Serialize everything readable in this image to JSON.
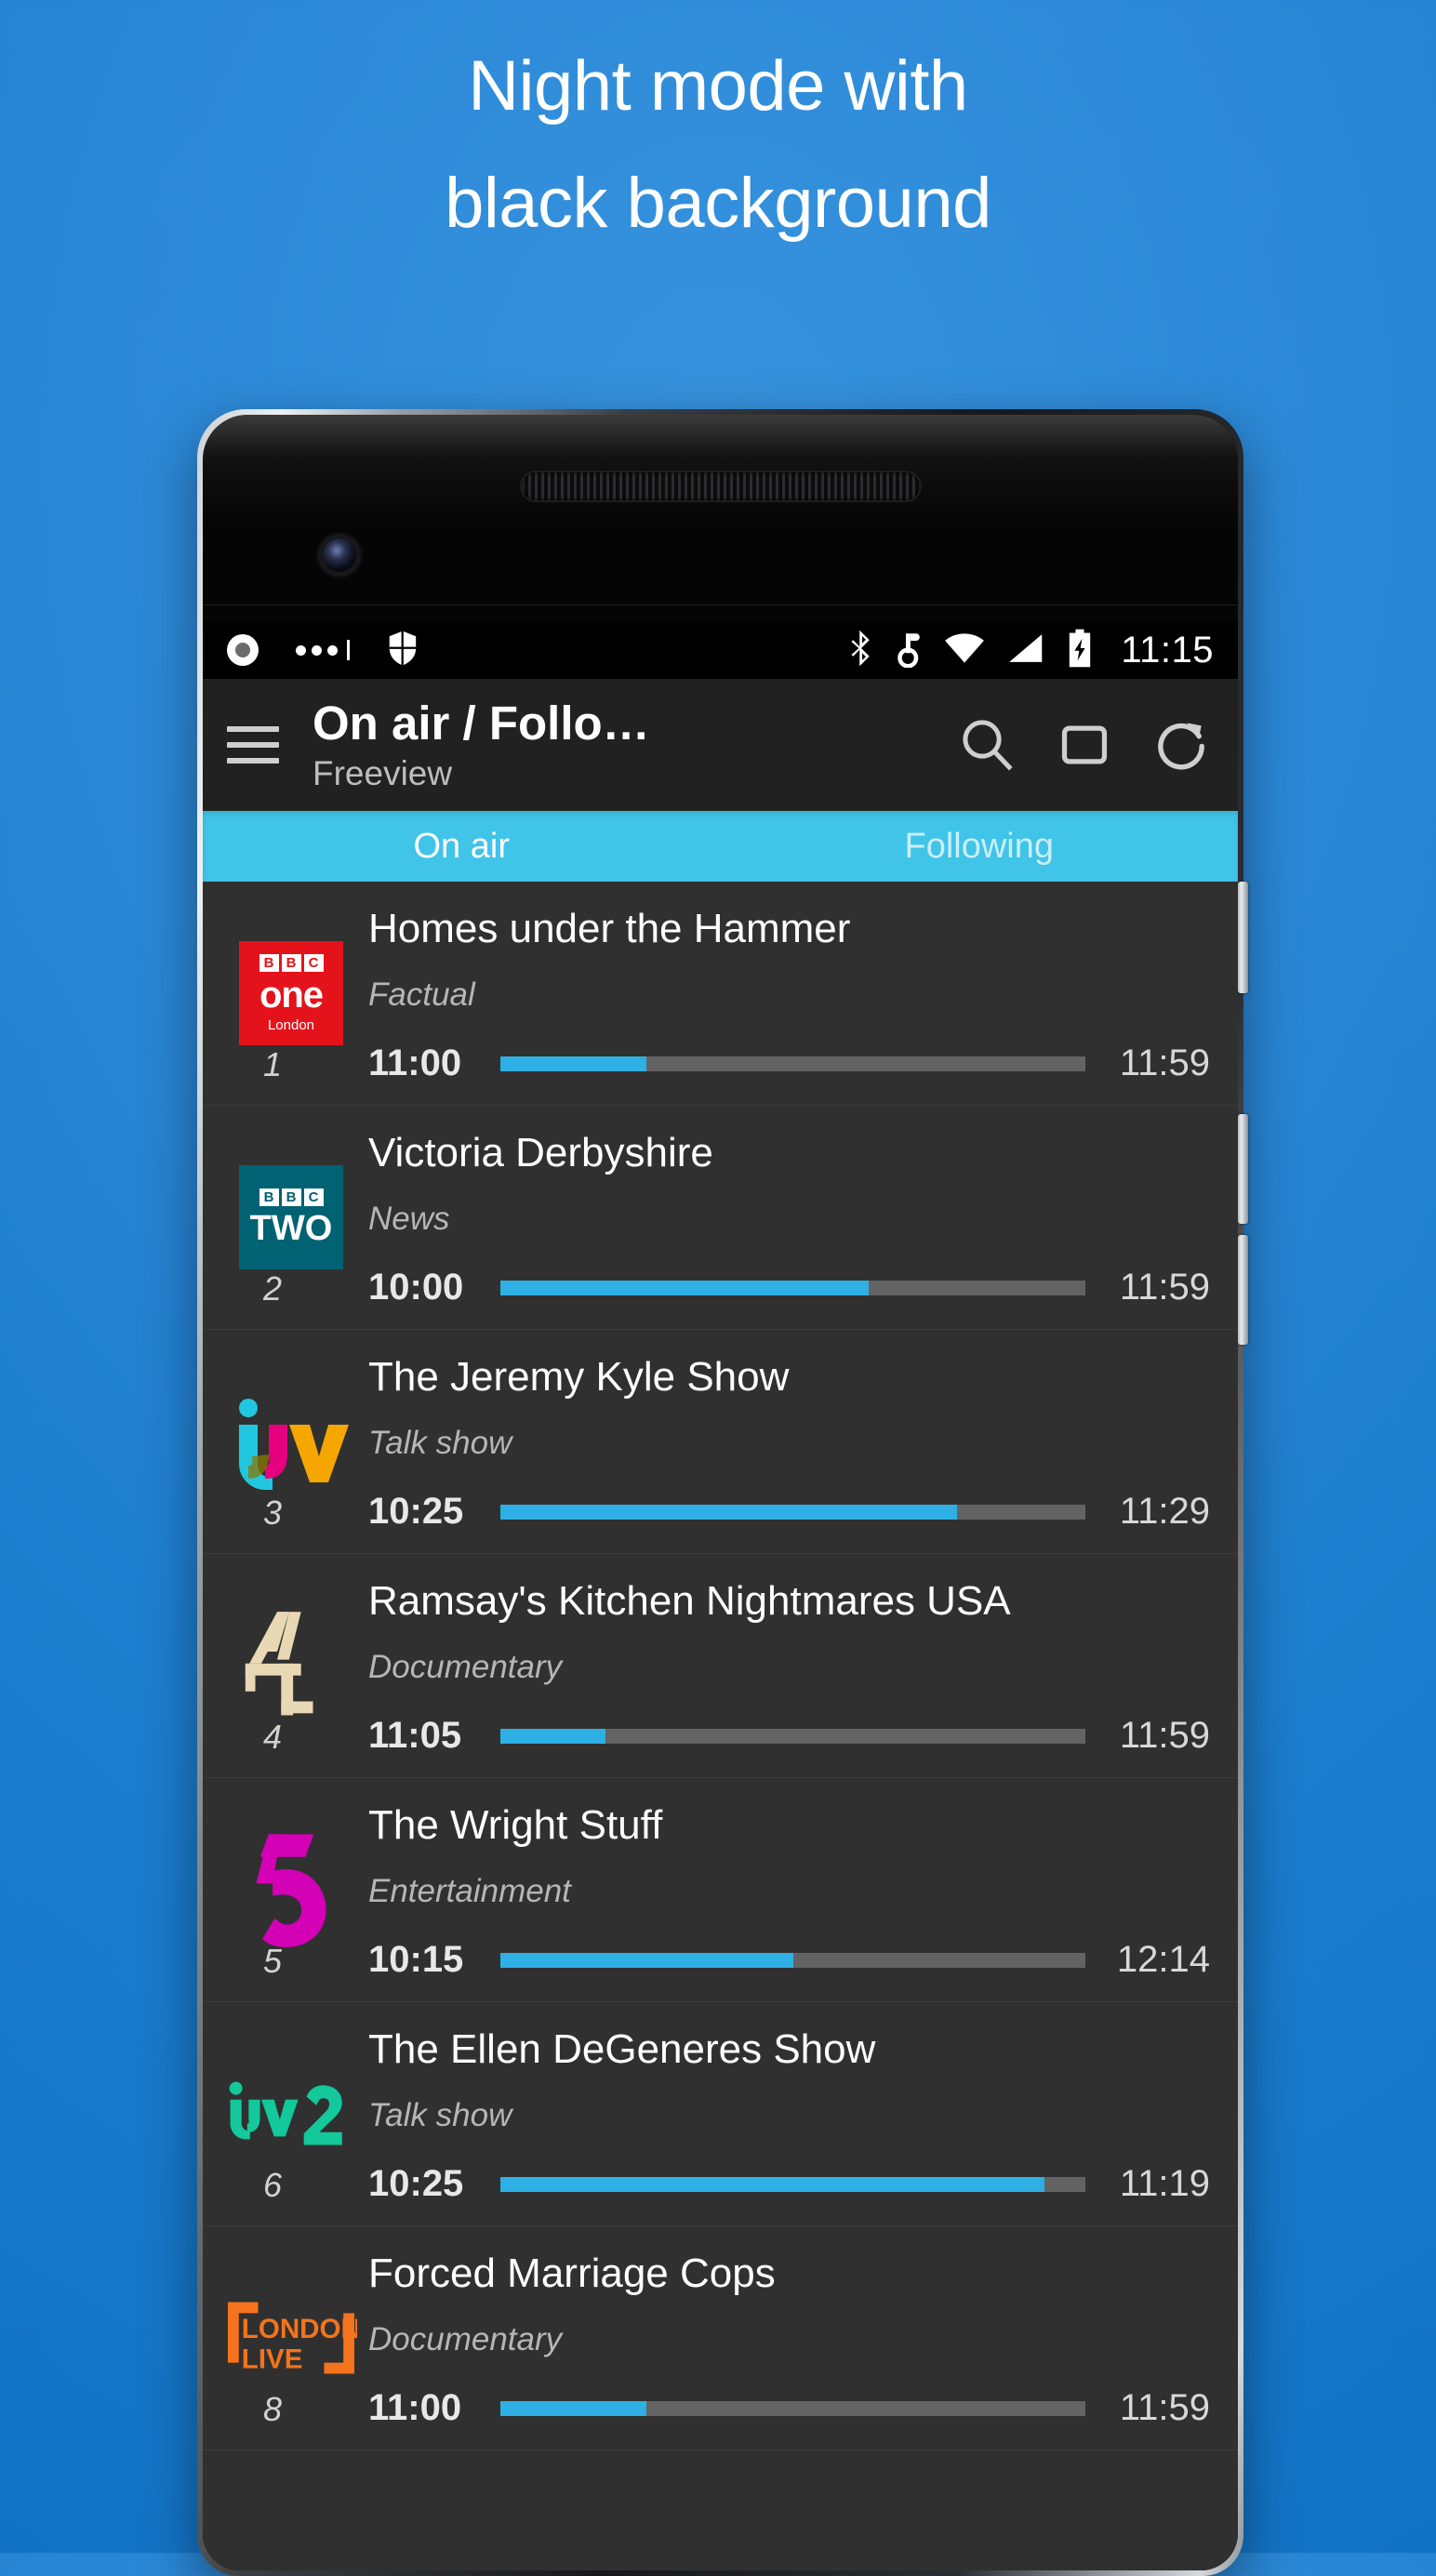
{
  "promo": {
    "line1": "Night mode with",
    "line2": "black background"
  },
  "statusbar": {
    "icons": [
      "record-icon",
      "more-dots-icon",
      "shield-icon",
      "bluetooth-icon",
      "vibrate-icon",
      "wifi-icon",
      "cellular-signal-icon",
      "battery-charging-icon"
    ],
    "time": "11:15"
  },
  "toolbar": {
    "menu_icon": "hamburger-menu-icon",
    "title": "On air / Follo…",
    "subtitle": "Freeview",
    "actions": [
      "search-icon",
      "device-screen-icon",
      "refresh-icon"
    ]
  },
  "tabs": [
    {
      "label": "On air",
      "active": true
    },
    {
      "label": "Following",
      "active": false
    }
  ],
  "colors": {
    "accent": "#40c4e8",
    "progress": "#2fb0e4",
    "list_bg": "#303030",
    "toolbar_bg": "#212121",
    "page_bg": "#1b7ccd"
  },
  "list": [
    {
      "channel_number": "1",
      "channel_name": "BBC One London",
      "logo": "bbc-one-logo",
      "logo_color": "#e4131b",
      "title": "Homes under the Hammer",
      "genre": "Factual",
      "start": "11:00",
      "end": "11:59",
      "progress": 25
    },
    {
      "channel_number": "2",
      "channel_name": "BBC TWO",
      "logo": "bbc-two-logo",
      "logo_color": "#006272",
      "title": "Victoria Derbyshire",
      "genre": "News",
      "start": "10:00",
      "end": "11:59",
      "progress": 63
    },
    {
      "channel_number": "3",
      "channel_name": "ITV",
      "logo": "itv-logo",
      "logo_color": "#21c7e0",
      "title": "The Jeremy Kyle Show",
      "genre": "Talk show",
      "start": "10:25",
      "end": "11:29",
      "progress": 78
    },
    {
      "channel_number": "4",
      "channel_name": "Channel 4",
      "logo": "channel-4-logo",
      "logo_color": "#e8d8b4",
      "title": "Ramsay's Kitchen Nightmares USA",
      "genre": "Documentary",
      "start": "11:05",
      "end": "11:59",
      "progress": 18
    },
    {
      "channel_number": "5",
      "channel_name": "Channel 5",
      "logo": "channel-5-logo",
      "logo_color": "#d300b5",
      "title": "The Wright Stuff",
      "genre": "Entertainment",
      "start": "10:15",
      "end": "12:14",
      "progress": 50
    },
    {
      "channel_number": "6",
      "channel_name": "ITV2",
      "logo": "itv2-logo",
      "logo_color": "#13c89b",
      "title": "The Ellen DeGeneres Show",
      "genre": "Talk show",
      "start": "10:25",
      "end": "11:19",
      "progress": 93
    },
    {
      "channel_number": "8",
      "channel_name": "LONDON LIVE",
      "logo": "london-live-logo",
      "logo_color": "#f4731c",
      "title": "Forced Marriage Cops",
      "genre": "Documentary",
      "start": "11:00",
      "end": "11:59",
      "progress": 25
    }
  ]
}
